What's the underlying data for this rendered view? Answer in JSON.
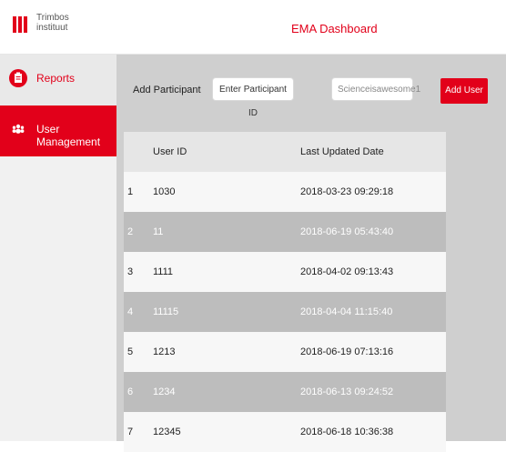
{
  "header": {
    "logo_line1": "Trimbos",
    "logo_line2": "instituut",
    "title": "EMA Dashboard"
  },
  "sidebar": {
    "items": [
      {
        "label": "Reports",
        "icon": "clipboard-icon"
      },
      {
        "label": "User Management",
        "icon": "users-icon"
      }
    ]
  },
  "add_participant": {
    "label": "Add Participant",
    "participant_id_placeholder": "Enter Participant ID",
    "password_value": "Scienceisawesome1",
    "button_label": "Add User"
  },
  "table": {
    "columns": [
      "User ID",
      "Last Updated Date"
    ],
    "rows": [
      {
        "index": "1",
        "user_id": "1030",
        "date": "2018-03-23 09:29:18"
      },
      {
        "index": "2",
        "user_id": "11",
        "date": "2018-06-19 05:43:40"
      },
      {
        "index": "3",
        "user_id": "1111",
        "date": "2018-04-02 09:13:43"
      },
      {
        "index": "4",
        "user_id": "11115",
        "date": "2018-04-04 11:15:40"
      },
      {
        "index": "5",
        "user_id": "1213",
        "date": "2018-06-19 07:13:16"
      },
      {
        "index": "6",
        "user_id": "1234",
        "date": "2018-06-13 09:24:52"
      },
      {
        "index": "7",
        "user_id": "12345",
        "date": "2018-06-18 10:36:38"
      }
    ]
  },
  "colors": {
    "accent": "#e2001a"
  }
}
